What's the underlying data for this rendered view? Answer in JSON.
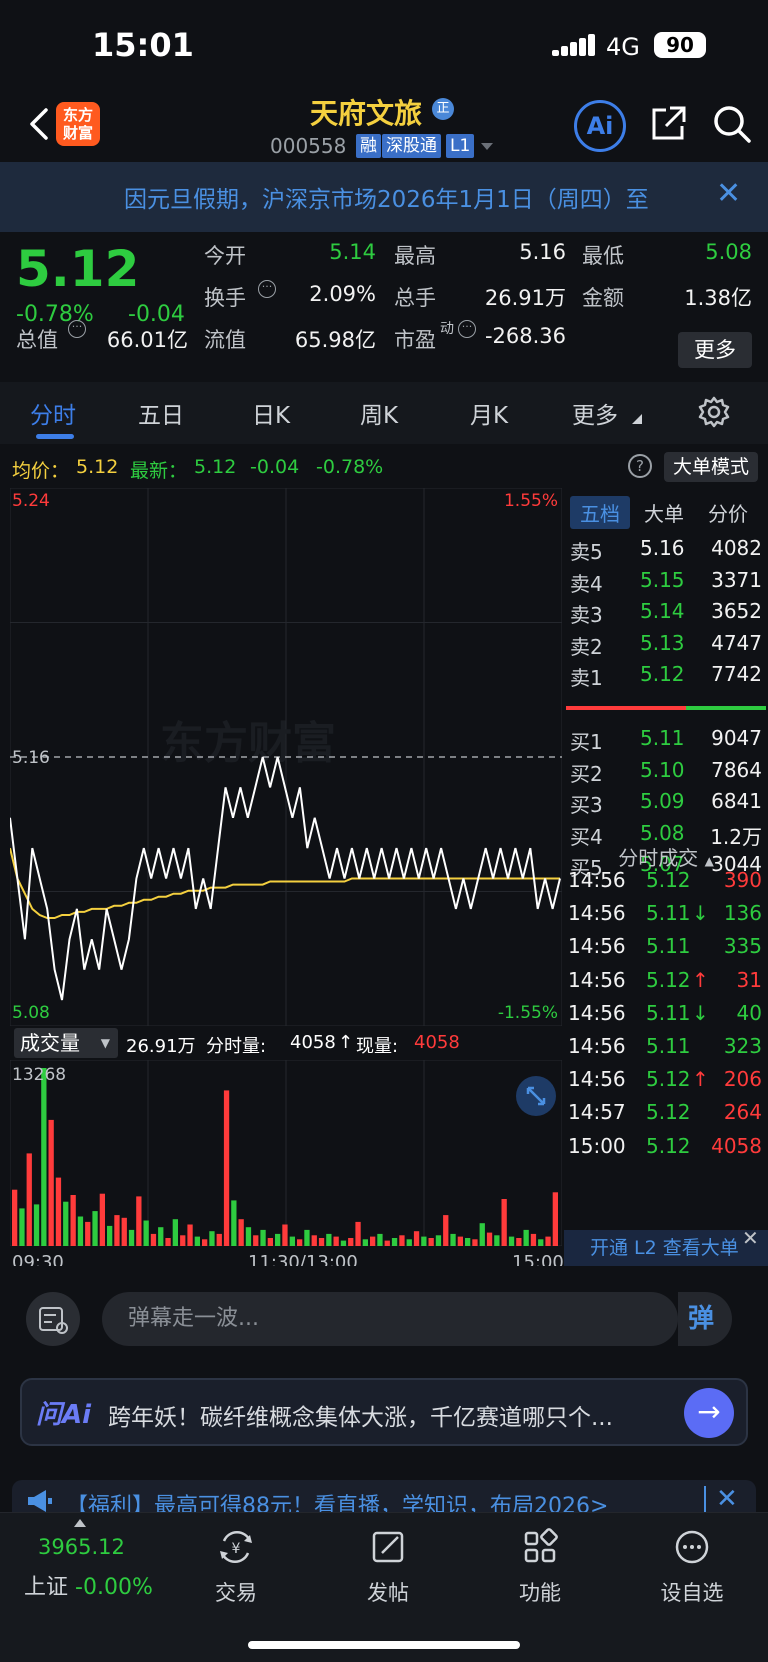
{
  "status_bar": {
    "time": "15:01",
    "network": "4G",
    "battery": "90"
  },
  "header": {
    "back": "back",
    "logo_line1": "东方",
    "logo_line2": "财富",
    "stock_name": "天府文旅",
    "name_badge": "正",
    "stock_code": "000558",
    "tags": [
      "融",
      "深股通",
      "L1"
    ],
    "ai_label": "Ai"
  },
  "notice": {
    "text": "因元旦假期，沪深京市场2026年1月1日（周四）至",
    "close": "✕"
  },
  "quote": {
    "price": "5.12",
    "change_pct": "-0.78%",
    "change_abs": "-0.04",
    "fields": [
      {
        "label": "今开",
        "value": "5.14",
        "color": "green"
      },
      {
        "label": "最高",
        "value": "5.16",
        "color": "white"
      },
      {
        "label": "最低",
        "value": "5.08",
        "color": "green"
      },
      {
        "label": "换手",
        "value": "2.09%",
        "color": "white"
      },
      {
        "label": "总手",
        "value": "26.91万",
        "color": "white"
      },
      {
        "label": "金额",
        "value": "1.38亿",
        "color": "white"
      },
      {
        "label": "总值",
        "value": "66.01亿",
        "color": "white"
      },
      {
        "label": "流值",
        "value": "65.98亿",
        "color": "white"
      },
      {
        "label": "市盈",
        "label_sup": "动",
        "value": "-268.36",
        "color": "white"
      }
    ],
    "more": "更多"
  },
  "tabs": [
    {
      "label": "分时",
      "active": true
    },
    {
      "label": "五日",
      "active": false
    },
    {
      "label": "日K",
      "active": false
    },
    {
      "label": "周K",
      "active": false
    },
    {
      "label": "月K",
      "active": false
    },
    {
      "label": "更多",
      "active": false
    }
  ],
  "avg_line": {
    "avg_label": "均价：",
    "avg_value": "5.12",
    "latest_label": "最新：",
    "latest_value": "5.12",
    "latest_chg": "-0.04",
    "latest_pct": "-0.78%",
    "help": "?",
    "big_mode": "大单模式"
  },
  "chart_data": {
    "type": "line",
    "price_axis": {
      "top": "5.24",
      "mid": "5.16",
      "bottom": "5.08"
    },
    "pct_axis": {
      "top": "1.55%",
      "bottom": "-1.55%"
    },
    "ylim": [
      5.08,
      5.24
    ],
    "prev_close": 5.16,
    "price_series": [
      5.14,
      5.12,
      5.1,
      5.13,
      5.12,
      5.11,
      5.09,
      5.08,
      5.1,
      5.11,
      5.09,
      5.1,
      5.09,
      5.11,
      5.1,
      5.09,
      5.1,
      5.12,
      5.13,
      5.12,
      5.13,
      5.12,
      5.13,
      5.12,
      5.13,
      5.11,
      5.12,
      5.11,
      5.13,
      5.15,
      5.14,
      5.15,
      5.14,
      5.15,
      5.16,
      5.15,
      5.16,
      5.15,
      5.14,
      5.15,
      5.13,
      5.14,
      5.13,
      5.12,
      5.13,
      5.12,
      5.13,
      5.12,
      5.13,
      5.12,
      5.13,
      5.12,
      5.13,
      5.12,
      5.13,
      5.12,
      5.13,
      5.12,
      5.13,
      5.12,
      5.11,
      5.12,
      5.11,
      5.12,
      5.13,
      5.12,
      5.13,
      5.12,
      5.13,
      5.12,
      5.13,
      5.11,
      5.12,
      5.11,
      5.12
    ],
    "avg_series": [
      5.13,
      5.12,
      5.115,
      5.11,
      5.108,
      5.107,
      5.107,
      5.108,
      5.108,
      5.109,
      5.109,
      5.11,
      5.11,
      5.11,
      5.111,
      5.111,
      5.112,
      5.112,
      5.113,
      5.113,
      5.114,
      5.114,
      5.115,
      5.115,
      5.116,
      5.116,
      5.116,
      5.117,
      5.117,
      5.117,
      5.118,
      5.118,
      5.118,
      5.118,
      5.118,
      5.119,
      5.119,
      5.119,
      5.119,
      5.119,
      5.119,
      5.119,
      5.119,
      5.119,
      5.119,
      5.119,
      5.12,
      5.12,
      5.12,
      5.12,
      5.12,
      5.12,
      5.12,
      5.12,
      5.12,
      5.12,
      5.12,
      5.12,
      5.12,
      5.12,
      5.12,
      5.12,
      5.12,
      5.12,
      5.12,
      5.12,
      5.12,
      5.12,
      5.12,
      5.12,
      5.12,
      5.12,
      5.12,
      5.12,
      5.12
    ],
    "volume_header": {
      "selector": "成交量",
      "total": "26.91万",
      "label_fs": "分时量:",
      "fs_value": "4058",
      "arrow": "↑",
      "label_now": "现量:",
      "now_value": "4058"
    },
    "volume_axis_max": "13268",
    "volume_series": [
      4200,
      2800,
      6900,
      3100,
      13268,
      9400,
      5100,
      3300,
      3800,
      2200,
      1800,
      2600,
      3900,
      1500,
      2300,
      2100,
      1200,
      3700,
      1900,
      900,
      1400,
      600,
      2000,
      800,
      1600,
      700,
      500,
      1100,
      900,
      11600,
      3400,
      2000,
      1400,
      800,
      1200,
      600,
      900,
      1600,
      700,
      500,
      1200,
      800,
      600,
      900,
      700,
      400,
      600,
      1800,
      500,
      700,
      900,
      400,
      600,
      800,
      500,
      1100,
      700,
      600,
      800,
      2300,
      900,
      700,
      600,
      500,
      1700,
      1000,
      800,
      3500,
      700,
      600,
      1200,
      900,
      500,
      700,
      4000
    ],
    "volume_colors": [
      "red",
      "green",
      "red",
      "green",
      "green",
      "red",
      "red",
      "green",
      "red",
      "green",
      "red",
      "green",
      "red",
      "green",
      "red",
      "red",
      "green",
      "red",
      "green",
      "red",
      "green",
      "red",
      "green",
      "red",
      "red",
      "green",
      "red",
      "green",
      "red",
      "red",
      "green",
      "red",
      "green",
      "red",
      "green",
      "red",
      "green",
      "red",
      "green",
      "red",
      "green",
      "red",
      "red",
      "green",
      "red",
      "green",
      "red",
      "red",
      "green",
      "red",
      "green",
      "red",
      "green",
      "red",
      "green",
      "red",
      "green",
      "red",
      "green",
      "red",
      "green",
      "red",
      "green",
      "red",
      "green",
      "red",
      "green",
      "red",
      "green",
      "red",
      "green",
      "red",
      "green",
      "red",
      "red"
    ],
    "time_labels": [
      "09:30",
      "11:30/13:00",
      "15:00"
    ]
  },
  "panel": {
    "tabs": [
      "五档",
      "大单",
      "分价"
    ],
    "asks": [
      {
        "label": "卖5",
        "price": "5.16",
        "vol": "4082",
        "color": "white"
      },
      {
        "label": "卖4",
        "price": "5.15",
        "vol": "3371",
        "color": "green"
      },
      {
        "label": "卖3",
        "price": "5.14",
        "vol": "3652",
        "color": "green"
      },
      {
        "label": "卖2",
        "price": "5.13",
        "vol": "4747",
        "color": "green"
      },
      {
        "label": "卖1",
        "price": "5.12",
        "vol": "7742",
        "color": "green"
      }
    ],
    "bids": [
      {
        "label": "买1",
        "price": "5.11",
        "vol": "9047",
        "color": "green"
      },
      {
        "label": "买2",
        "price": "5.10",
        "vol": "7864",
        "color": "green"
      },
      {
        "label": "买3",
        "price": "5.09",
        "vol": "6841",
        "color": "green"
      },
      {
        "label": "买4",
        "price": "5.08",
        "vol": "1.2万",
        "color": "green"
      },
      {
        "label": "买5",
        "price": "5.07",
        "vol": "3044",
        "color": "green"
      }
    ],
    "trades_title": "分时成交",
    "trades": [
      {
        "time": "14:56",
        "price": "5.12",
        "arrow": "",
        "vol": "390",
        "vcolor": "red"
      },
      {
        "time": "14:56",
        "price": "5.11",
        "arrow": "↓",
        "vol": "136",
        "vcolor": "green"
      },
      {
        "time": "14:56",
        "price": "5.11",
        "arrow": "",
        "vol": "335",
        "vcolor": "green"
      },
      {
        "time": "14:56",
        "price": "5.12",
        "arrow": "↑",
        "vol": "31",
        "vcolor": "red"
      },
      {
        "time": "14:56",
        "price": "5.11",
        "arrow": "↓",
        "vol": "40",
        "vcolor": "green"
      },
      {
        "time": "14:56",
        "price": "5.11",
        "arrow": "",
        "vol": "323",
        "vcolor": "green"
      },
      {
        "time": "14:56",
        "price": "5.12",
        "arrow": "↑",
        "vol": "206",
        "vcolor": "red"
      },
      {
        "time": "14:57",
        "price": "5.12",
        "arrow": "",
        "vol": "264",
        "vcolor": "red"
      },
      {
        "time": "15:00",
        "price": "5.12",
        "arrow": "",
        "vol": "4058",
        "vcolor": "red"
      }
    ],
    "l2_text": "开通 L2 查看大单",
    "l2_close": "✕"
  },
  "comment": {
    "placeholder": "弹幕走一波...",
    "danmu": "弹"
  },
  "ai_bar": {
    "logo": "问Ai",
    "text": "跨年妖！碳纤维概念集体大涨，千亿赛道哪只个...",
    "go": "→"
  },
  "promo": {
    "text": "【福利】最高可得88元！看直播，学知识，布局2026>",
    "close": "✕"
  },
  "nav": {
    "index_value": "3965.12",
    "index_name": "上证",
    "index_chg": "-0.00%",
    "items": [
      "交易",
      "发帖",
      "功能",
      "设自选"
    ]
  },
  "colors": {
    "up": "#ff3b3b",
    "down": "#2ecc40",
    "accent": "#3d7ee8",
    "avg": "#f4d03f"
  }
}
